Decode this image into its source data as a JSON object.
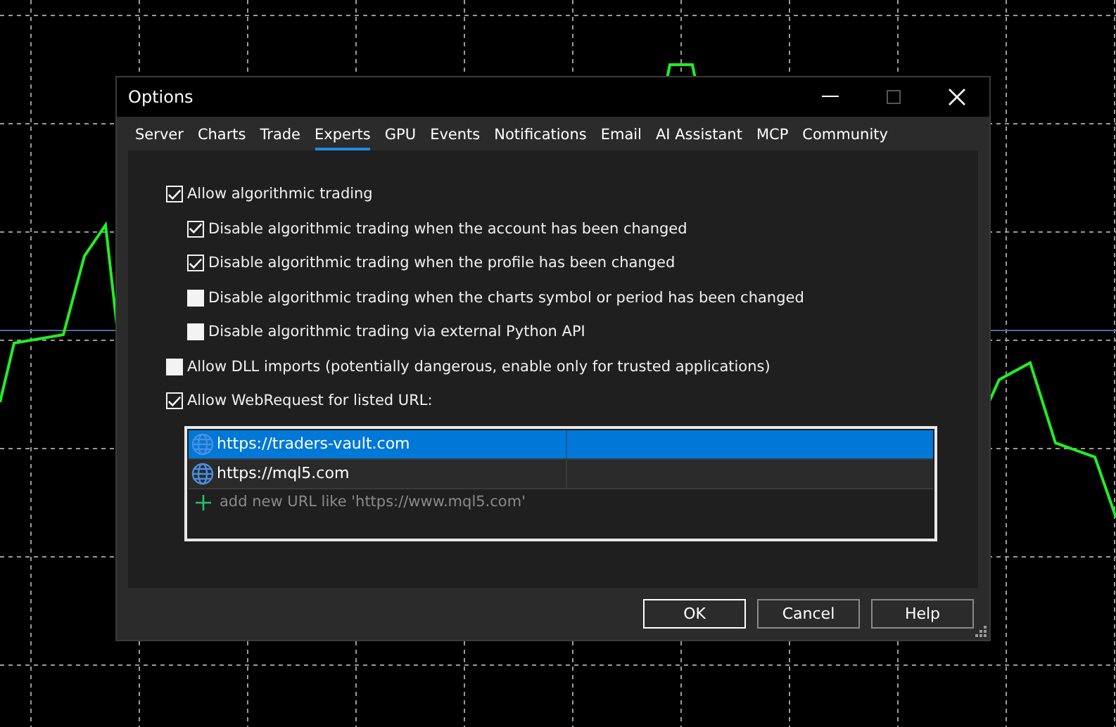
{
  "window": {
    "title": "Options"
  },
  "tabs": [
    {
      "label": "Server",
      "selected": false
    },
    {
      "label": "Charts",
      "selected": false
    },
    {
      "label": "Trade",
      "selected": false
    },
    {
      "label": "Experts",
      "selected": true
    },
    {
      "label": "GPU",
      "selected": false
    },
    {
      "label": "Events",
      "selected": false
    },
    {
      "label": "Notifications",
      "selected": false
    },
    {
      "label": "Email",
      "selected": false
    },
    {
      "label": "AI Assistant",
      "selected": false
    },
    {
      "label": "MCP",
      "selected": false
    },
    {
      "label": "Community",
      "selected": false
    }
  ],
  "options": [
    {
      "label": "Allow algorithmic trading",
      "checked": true,
      "children": [
        {
          "label": "Disable algorithmic trading when the account has been changed",
          "checked": true
        },
        {
          "label": "Disable algorithmic trading when the profile has been changed",
          "checked": true
        },
        {
          "label": "Disable algorithmic trading when the charts symbol or period has been changed",
          "checked": false
        },
        {
          "label": "Disable algorithmic trading via external Python API",
          "checked": false
        }
      ]
    },
    {
      "label": "Allow DLL imports (potentially dangerous, enable only for trusted applications)",
      "checked": false
    },
    {
      "label": "Allow WebRequest for listed URL:",
      "checked": true
    }
  ],
  "url_list": {
    "rows": [
      {
        "url": "https://traders-vault.com",
        "selected": true
      },
      {
        "url": "https://mql5.com",
        "selected": false
      }
    ],
    "add_hint": "add new URL like 'https://www.mql5.com'"
  },
  "buttons": [
    {
      "label": "OK",
      "selected": true
    },
    {
      "label": "Cancel",
      "selected": false
    },
    {
      "label": "Help",
      "selected": false
    }
  ]
}
